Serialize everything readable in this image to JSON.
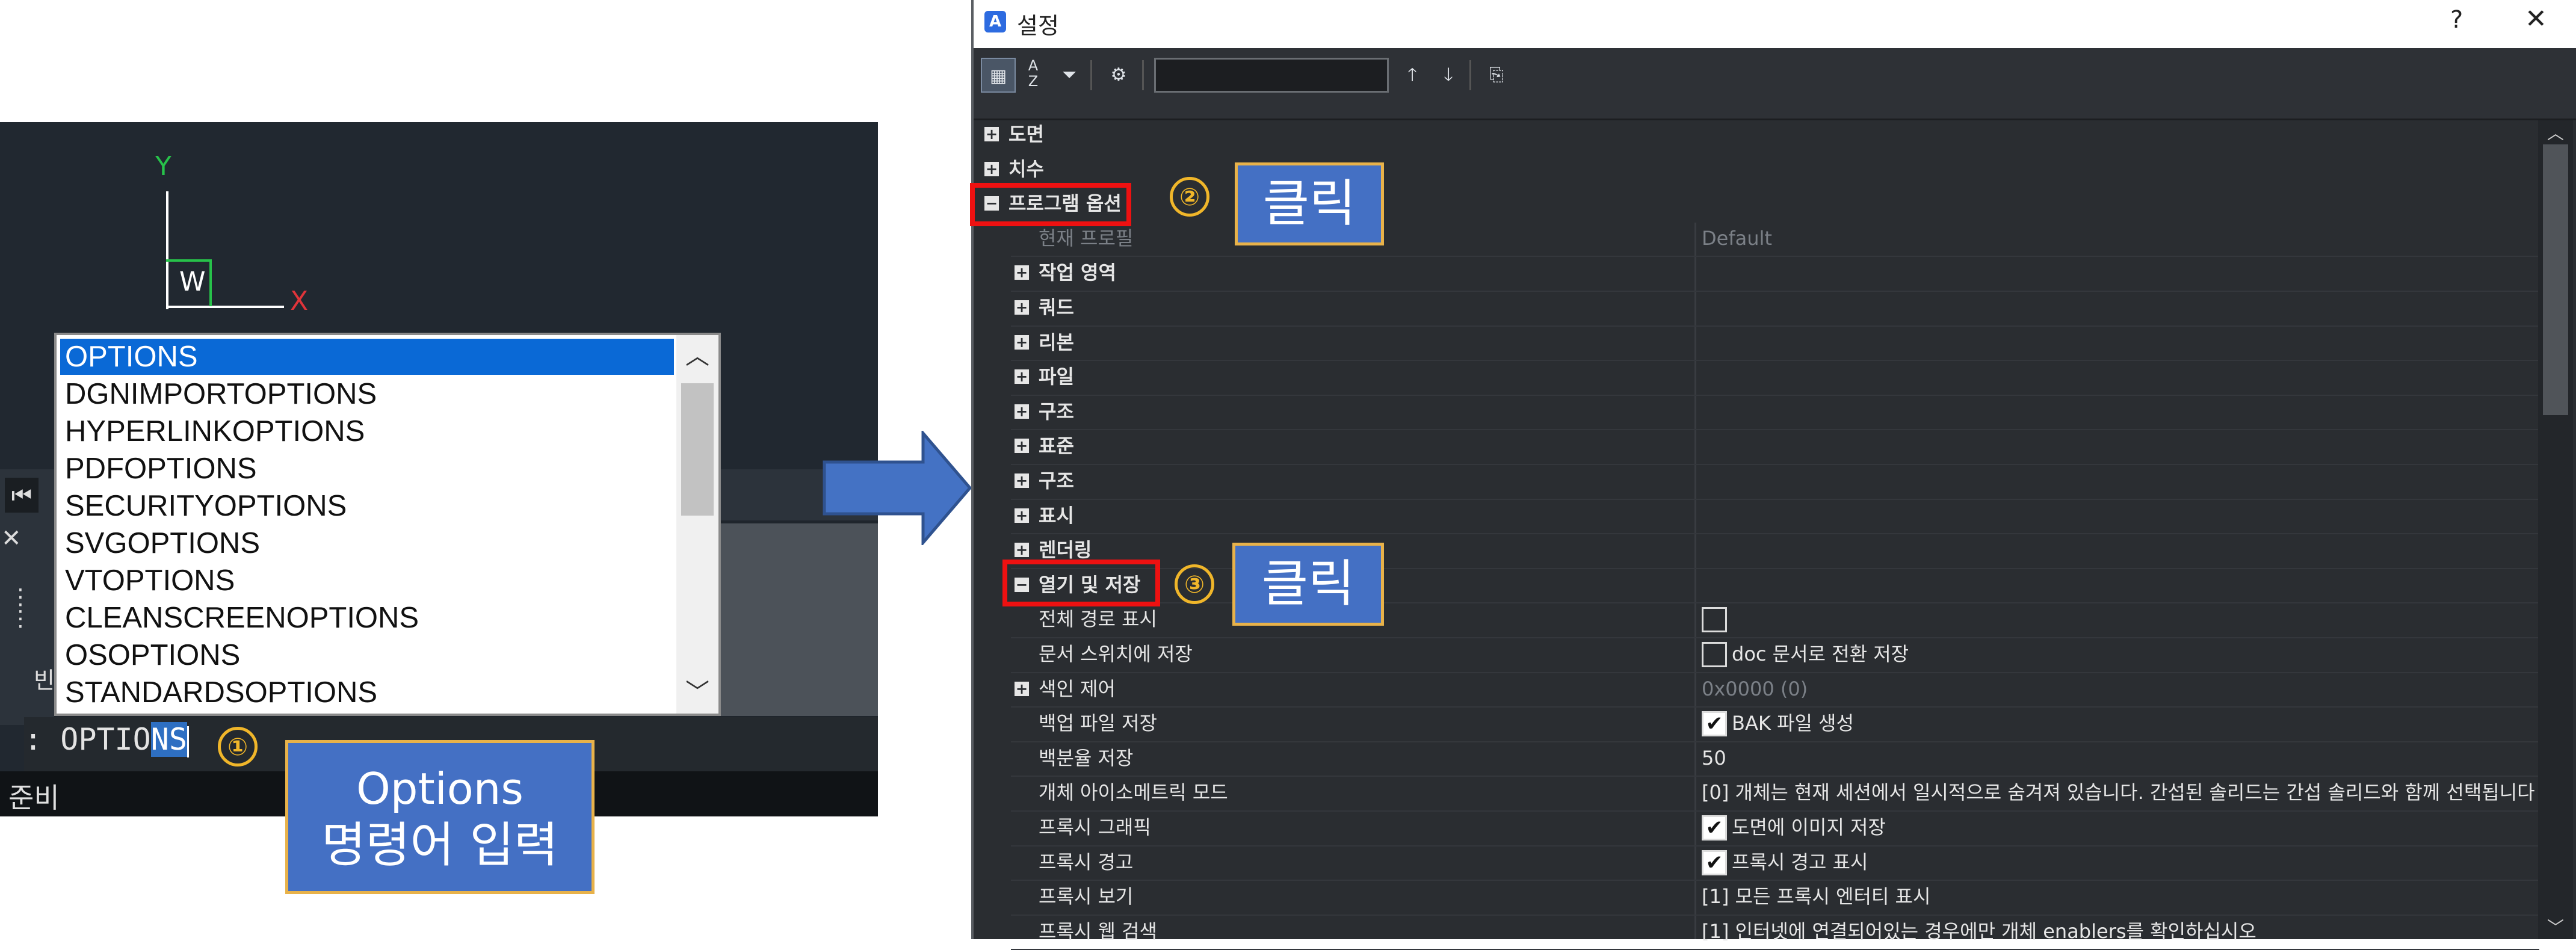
{
  "cad": {
    "axis_y": "Y",
    "axis_x": "X",
    "ucs_label": "W",
    "side_label": "빈",
    "command_prompt": ": ",
    "command_typed_plain": "OPTIO",
    "command_typed_selected": "NS",
    "status": "준비",
    "autocomplete": [
      "OPTIONS",
      "DGNIMPORTOPTIONS",
      "HYPERLINKOPTIONS",
      "PDFOPTIONS",
      "SECURITYOPTIONS",
      "SVGOPTIONS",
      "VTOPTIONS",
      "CLEANSCREENOPTIONS",
      "OSOPTIONS",
      "STANDARDSOPTIONS"
    ],
    "selected_index": 0
  },
  "callouts": {
    "step1_badge": "①",
    "step1_line1": "Options",
    "step1_line2": "명령어 입력",
    "step2_badge": "②",
    "step2_text": "클릭",
    "step3_badge": "③",
    "step3_text": "클릭"
  },
  "dialog": {
    "title": "설정",
    "help": "?",
    "close": "✕",
    "search_value": "",
    "value_header": "Default",
    "tree": [
      {
        "label": "도면",
        "level": 0,
        "expander": "+",
        "bold": true
      },
      {
        "label": "치수",
        "level": 0,
        "expander": "+",
        "bold": true
      },
      {
        "label": "프로그램 옵션",
        "level": 0,
        "expander": "−",
        "bold": true
      },
      {
        "label": "현재 프로필",
        "level": 1,
        "dim": true,
        "value": "Default"
      },
      {
        "label": "작업 영역",
        "level": 1,
        "expander": "+",
        "bold": true
      },
      {
        "label": "쿼드",
        "level": 1,
        "expander": "+",
        "bold": true
      },
      {
        "label": "리본",
        "level": 1,
        "expander": "+",
        "bold": true
      },
      {
        "label": "파일",
        "level": 1,
        "expander": "+",
        "bold": true
      },
      {
        "label": "구조",
        "level": 1,
        "expander": "+",
        "bold": true
      },
      {
        "label": "표준",
        "level": 1,
        "expander": "+",
        "bold": true
      },
      {
        "label": "구조",
        "level": 1,
        "expander": "+",
        "bold": true
      },
      {
        "label": "표시",
        "level": 1,
        "expander": "+",
        "bold": true
      },
      {
        "label": "렌더링",
        "level": 1,
        "expander": "+",
        "bold": true
      },
      {
        "label": "열기 및 저장",
        "level": 1,
        "expander": "−",
        "bold": true
      },
      {
        "label": "전체 경로 표시",
        "level": 2,
        "check": "off",
        "value": ""
      },
      {
        "label": "문서 스위치에 저장",
        "level": 2,
        "check": "off",
        "value": "doc 문서로 전환 저장"
      },
      {
        "label": "색인 제어",
        "level": 1,
        "expander": "+",
        "value": "0x0000 (0)",
        "value_dim": true
      },
      {
        "label": "백업 파일 저장",
        "level": 2,
        "check": "on",
        "value": "BAK 파일 생성"
      },
      {
        "label": "백분율 저장",
        "level": 2,
        "value": "50"
      },
      {
        "label": "개체 아이소메트릭 모드",
        "level": 2,
        "value": "[0] 개체는 현재 세션에서 일시적으로 숨겨져 있습니다. 간섭된 솔리드는 간섭 솔리드와 함께 선택됩니다"
      },
      {
        "label": "프록시 그래픽",
        "level": 2,
        "check": "on",
        "value": "도면에 이미지 저장"
      },
      {
        "label": "프록시 경고",
        "level": 2,
        "check": "on",
        "value": "프록시 경고 표시"
      },
      {
        "label": "프록시 보기",
        "level": 2,
        "value": "[1] 모든 프록시 엔터티 표시"
      },
      {
        "label": "프록시 웹 검색",
        "level": 2,
        "value": "[1] 인터넷에 연결되어있는 경우에만 개체 enablers를 확인하십시오"
      }
    ]
  }
}
